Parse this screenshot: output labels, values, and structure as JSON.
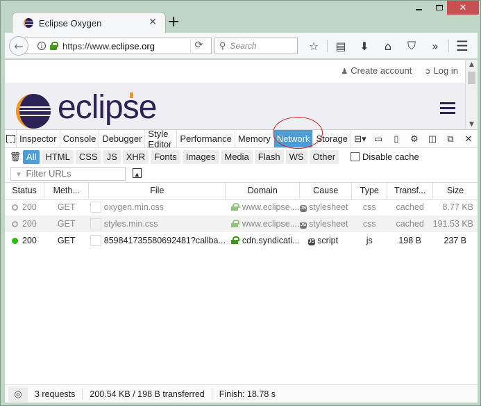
{
  "window": {
    "minimize_icon": "minimize-icon",
    "maximize_icon": "maximize-icon",
    "close_icon": "close-icon",
    "close_glyph": "✕"
  },
  "tab": {
    "title": "Eclipse Oxygen",
    "close_glyph": "✕",
    "new_tab_glyph": "+"
  },
  "navbar": {
    "back_glyph": "←",
    "url_prefix": "https://www.",
    "url_domain": "eclipse.org",
    "reload_glyph": "⟳",
    "search_placeholder": "Search",
    "search_glyph": "⚲",
    "icons": [
      {
        "name": "bookmark-star-icon",
        "glyph": "☆"
      },
      {
        "name": "reading-list-icon",
        "glyph": "▤"
      },
      {
        "name": "download-icon",
        "glyph": "⬇"
      },
      {
        "name": "home-icon",
        "glyph": "⌂"
      },
      {
        "name": "pocket-icon",
        "glyph": "⛉"
      },
      {
        "name": "overflow-chevron-icon",
        "glyph": "»"
      },
      {
        "name": "menu-icon",
        "glyph": "☰"
      }
    ]
  },
  "page": {
    "create_account": "Create account",
    "log_in": "Log in",
    "user_glyph": "♟",
    "login_glyph": "➲",
    "logo_text": "eclipse",
    "scroll_up": "▲",
    "scroll_down": "▼"
  },
  "devtools": {
    "tools": [
      "Inspector",
      "Console",
      "Debugger",
      "Style Editor",
      "Performance",
      "Memory",
      "Network",
      "Storage"
    ],
    "active_tool": "Network",
    "toolbar_icons": [
      {
        "name": "layout-toggle-icon",
        "glyph": "⊟▾"
      },
      {
        "name": "split-console-icon",
        "glyph": "▭"
      },
      {
        "name": "responsive-mode-icon",
        "glyph": "▯"
      },
      {
        "name": "settings-gear-icon",
        "glyph": "⚙"
      },
      {
        "name": "dock-side-icon",
        "glyph": "◫"
      },
      {
        "name": "undock-window-icon",
        "glyph": "⧉"
      },
      {
        "name": "close-devtools-icon",
        "glyph": "✕"
      }
    ],
    "clear_glyph": "🗑",
    "filters": [
      "All",
      "HTML",
      "CSS",
      "JS",
      "XHR",
      "Fonts",
      "Images",
      "Media",
      "Flash",
      "WS",
      "Other"
    ],
    "active_filter": "All",
    "disable_cache_label": "Disable cache",
    "disable_cache_checked": false,
    "filter_urls_placeholder": "Filter URLs",
    "columns": [
      "Status",
      "Meth...",
      "File",
      "Domain",
      "Cause",
      "Type",
      "Transf...",
      "Size"
    ],
    "requests": [
      {
        "status": "200",
        "status_state": "cached",
        "method": "GET",
        "file": "oxygen.min.css",
        "domain": "www.eclipse....",
        "secure": true,
        "cause": "stylesheet",
        "type": "css",
        "transferred": "cached",
        "size": "8.77 KB"
      },
      {
        "status": "200",
        "status_state": "cached",
        "method": "GET",
        "file": "styles.min.css",
        "domain": "www.eclipse....",
        "secure": true,
        "cause": "stylesheet",
        "type": "css",
        "transferred": "cached",
        "size": "191.53 KB"
      },
      {
        "status": "200",
        "status_state": "ok",
        "method": "GET",
        "file": "859841735580692481?callba...",
        "domain": "cdn.syndicati...",
        "secure": true,
        "cause": "script",
        "type": "js",
        "transferred": "198 B",
        "size": "237 B"
      }
    ],
    "js_badge": "JS",
    "status": {
      "perf_glyph": "◎",
      "requests": "3 requests",
      "transferred": "200.54 KB / 198 B transferred",
      "finish": "Finish: 18.78 s"
    }
  }
}
